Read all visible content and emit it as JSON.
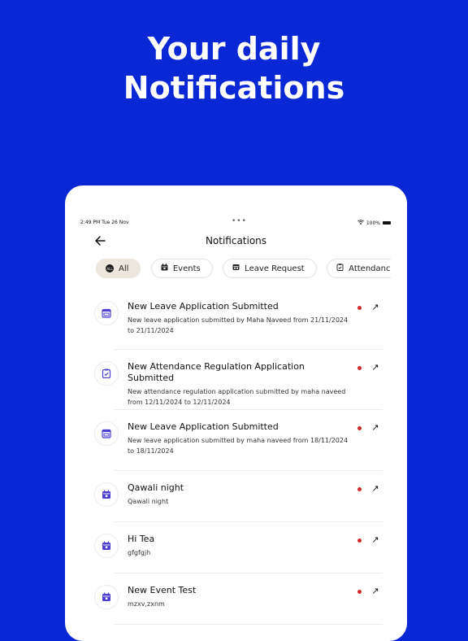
{
  "headline": {
    "line1": "Your daily",
    "line2": "Notifications"
  },
  "status_bar": {
    "time": "2:49 PM  Tue 26 Nov",
    "dots": "•••",
    "battery": "100%"
  },
  "header": {
    "title": "Notifications"
  },
  "filters": [
    {
      "label": "All",
      "icon": "all-icon",
      "active": true
    },
    {
      "label": "Events",
      "icon": "calendar-icon"
    },
    {
      "label": "Leave Request",
      "icon": "leave-icon"
    },
    {
      "label": "Attendance R",
      "icon": "attendance-icon"
    }
  ],
  "notifications": [
    {
      "type": "leave",
      "title": "New Leave Application Submitted",
      "desc": "New leave application submitted by Maha  Naveed from 21/11/2024 to 21/11/2024",
      "unread": true
    },
    {
      "type": "attendance",
      "title": "New Attendance Regulation Application Submitted",
      "desc": "New attendance regulation application submitted by maha  naveed from 12/11/2024 to 12/11/2024",
      "unread": true
    },
    {
      "type": "leave",
      "title": "New Leave Application Submitted",
      "desc": "New leave application submitted by maha  naveed from 18/11/2024 to 18/11/2024",
      "unread": true
    },
    {
      "type": "event",
      "title": "Qawali night",
      "desc": "Qawali night",
      "unread": true
    },
    {
      "type": "event",
      "title": "Hi Tea",
      "desc": "gfgfgjh",
      "unread": true
    },
    {
      "type": "event",
      "title": "New Event Test",
      "desc": "mzxv,zxnm",
      "unread": true
    }
  ],
  "colors": {
    "background": "#0a27d6",
    "accent_icon": "#4b3dd0",
    "unread_dot": "#d32b2b"
  }
}
